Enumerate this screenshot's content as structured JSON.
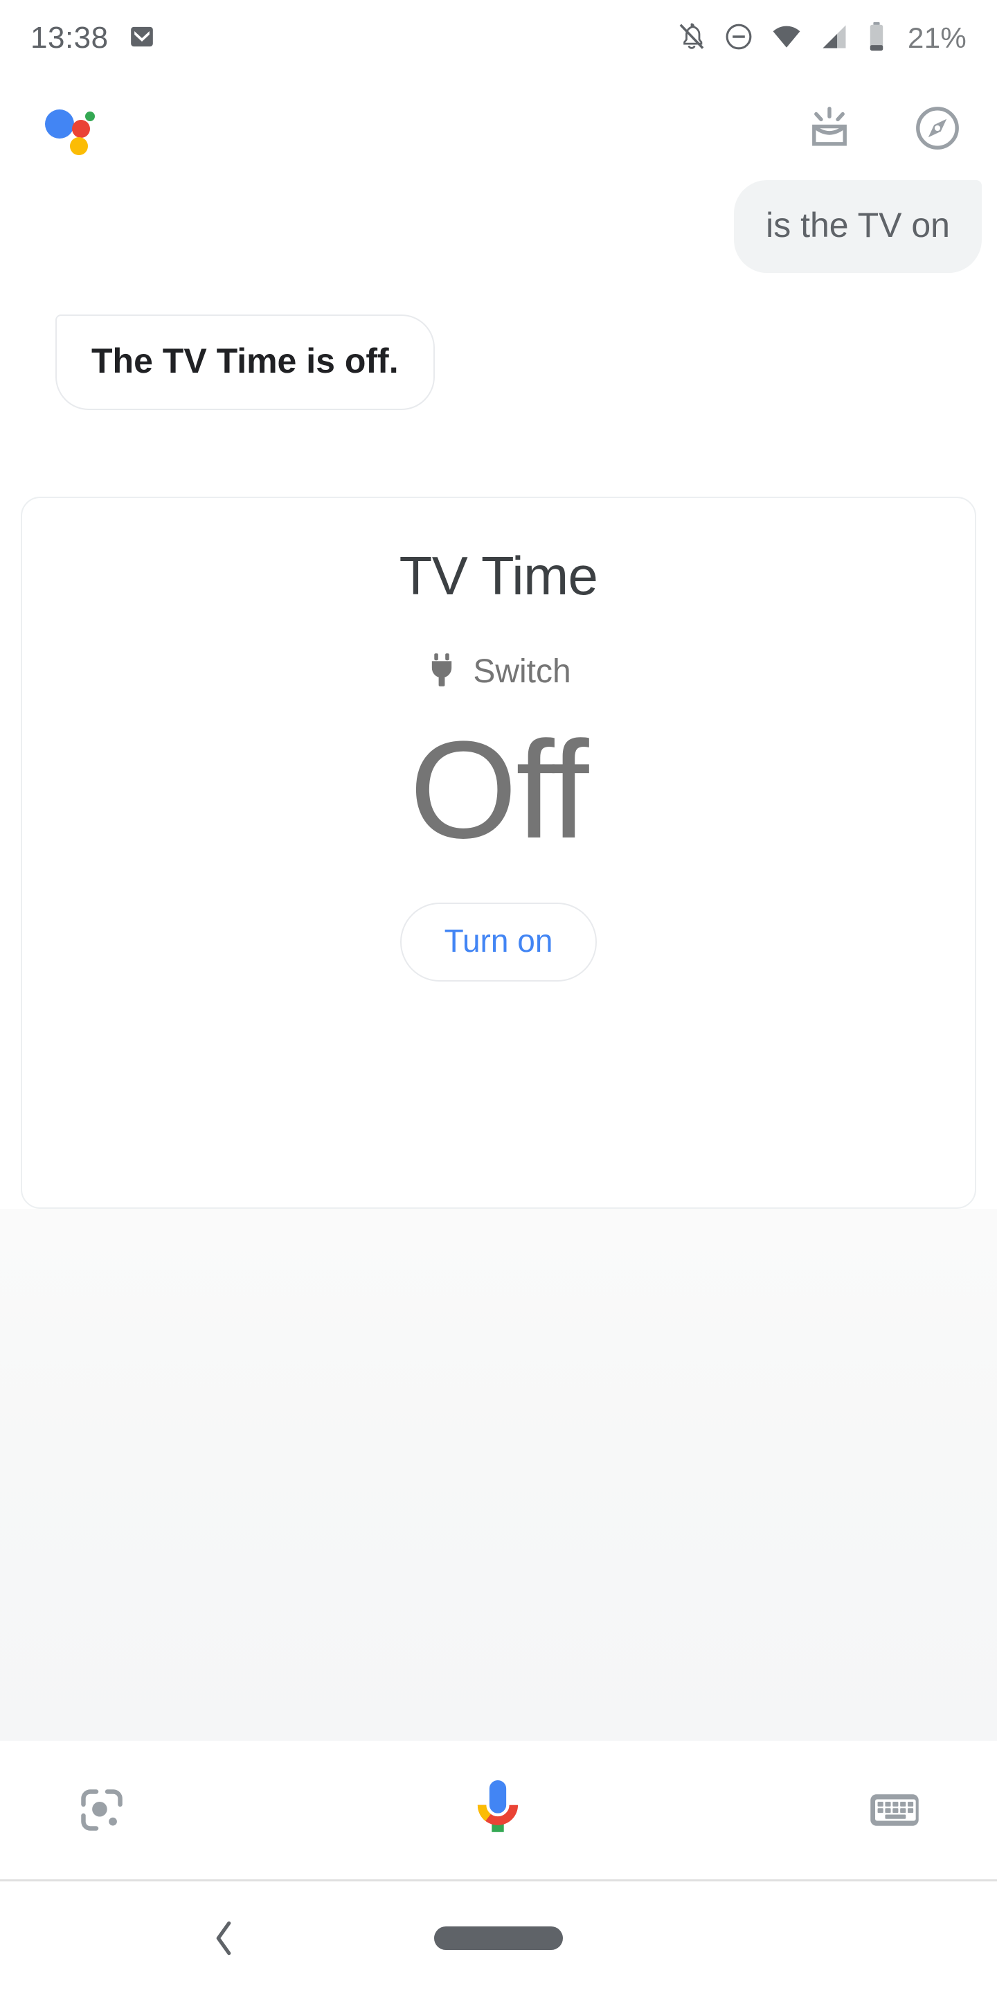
{
  "status_bar": {
    "clock": "13:38",
    "battery_percent": "21%",
    "icons": {
      "gmail": "gmail-icon",
      "notifications_silenced": "bell-off-icon",
      "do_not_disturb": "do-not-disturb-icon",
      "wifi": "wifi-icon",
      "cellular": "cellular-signal-icon",
      "battery": "battery-icon"
    }
  },
  "header": {
    "logo": "google-assistant-logo",
    "actions": [
      {
        "name": "snapshot-icon",
        "label": "Snapshot"
      },
      {
        "name": "explore-icon",
        "label": "Explore"
      }
    ]
  },
  "conversation": [
    {
      "role": "user",
      "text": "is the TV on"
    },
    {
      "role": "assistant",
      "text": "The TV Time is off."
    }
  ],
  "device_card": {
    "title": "TV Time",
    "trait_icon": "power-plug-icon",
    "trait_label": "Switch",
    "state": "Off",
    "action_label": "Turn on"
  },
  "bottom_bar": {
    "lens_label": "Google Lens",
    "mic_label": "Voice input",
    "keyboard_label": "Keyboard"
  },
  "nav_bar": {
    "back_label": "Back",
    "home_label": "Home"
  },
  "colors": {
    "google_blue": "#4285f4",
    "google_red": "#ea4335",
    "google_yellow": "#fbbc05",
    "google_green": "#34a853",
    "text_primary": "#202124",
    "text_secondary": "#5f6368",
    "state_gray": "#757575",
    "bubble_gray": "#f1f3f4",
    "border_gray": "#e8eaed",
    "icon_gray": "#9aa0a6"
  }
}
